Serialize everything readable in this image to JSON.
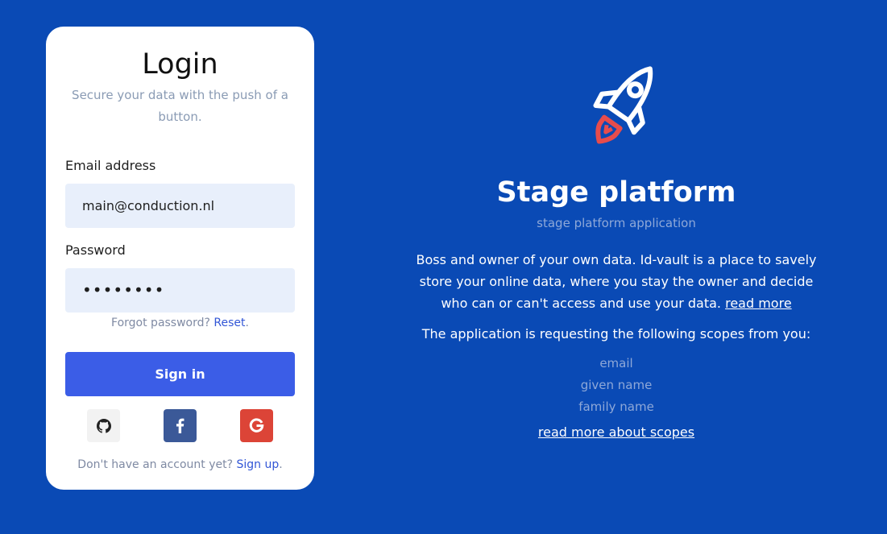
{
  "login": {
    "title": "Login",
    "subtitle": "Secure your data with the push of a button.",
    "email_label": "Email address",
    "email_value": "main@conduction.nl",
    "password_label": "Password",
    "password_value": "••••••••",
    "forgot_text": "Forgot password? ",
    "reset_link": "Reset",
    "forgot_suffix": ".",
    "signin_label": "Sign in",
    "social": [
      {
        "name": "github",
        "icon": "github-icon",
        "color": "#f2f2f2"
      },
      {
        "name": "facebook",
        "icon": "facebook-icon",
        "color": "#3b5998"
      },
      {
        "name": "google",
        "icon": "google-icon",
        "color": "#dc4437"
      }
    ],
    "signup_text": "Don't have an account yet? ",
    "signup_link": "Sign up",
    "signup_suffix": "."
  },
  "platform": {
    "icon": "rocket-icon",
    "title": "Stage platform",
    "subtitle": "stage platform application",
    "description": "Boss and owner of your own data. Id-vault is a place to savely store your online data, where you stay the owner and decide who can or can't access and use your data. ",
    "read_more": "read more",
    "request_text": "The application is requesting the following scopes from you:",
    "scopes": [
      "email",
      "given name",
      "family name"
    ],
    "scopes_link": "read more about scopes"
  },
  "colors": {
    "background": "#0a4ab5",
    "primary_button": "#3b5de7",
    "input_bg": "#e8effb",
    "rocket_flame": "#e74c4c"
  }
}
